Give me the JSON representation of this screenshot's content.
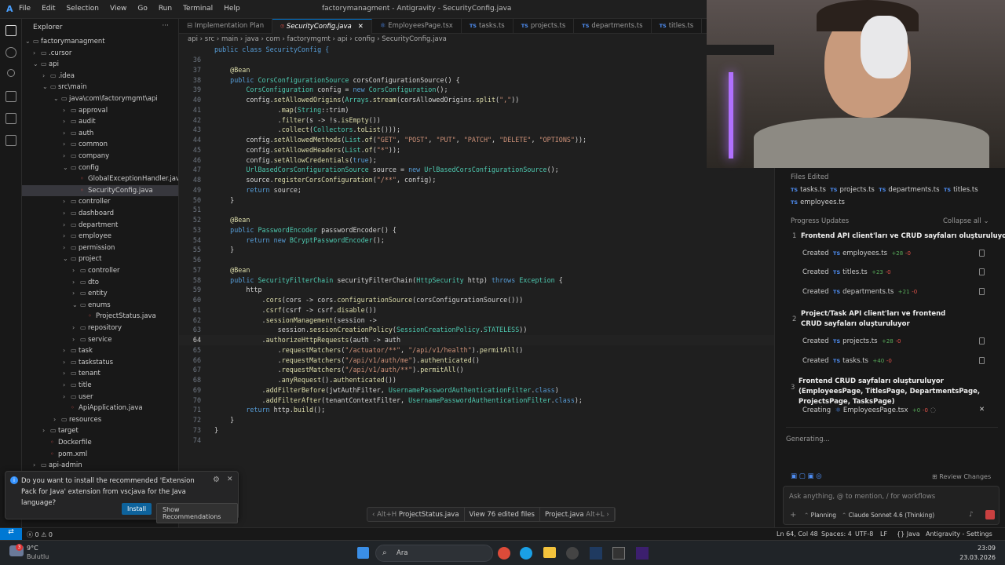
{
  "window": {
    "title": "factorymanagment - Antigravity - SecurityConfig.java"
  },
  "menu": [
    "File",
    "Edit",
    "Selection",
    "View",
    "Go",
    "Run",
    "Terminal",
    "Help"
  ],
  "explorer": {
    "header": "Explorer",
    "items": [
      {
        "label": "factorymanagment",
        "chev": "⌄"
      },
      {
        "label": ".cursor",
        "chev": "›"
      },
      {
        "label": "api",
        "chev": "⌄"
      },
      {
        "label": ".idea",
        "chev": "›"
      },
      {
        "label": "src\\main",
        "chev": "⌄"
      },
      {
        "label": "java\\com\\factorymgmt\\api",
        "chev": "⌄"
      },
      {
        "label": "approval",
        "chev": "›"
      },
      {
        "label": "audit",
        "chev": "›"
      },
      {
        "label": "auth",
        "chev": "›"
      },
      {
        "label": "common",
        "chev": "›"
      },
      {
        "label": "company",
        "chev": "›"
      },
      {
        "label": "config",
        "chev": "⌄"
      },
      {
        "label": "GlobalExceptionHandler.java",
        "chev": ""
      },
      {
        "label": "SecurityConfig.java",
        "chev": ""
      },
      {
        "label": "controller",
        "chev": "›"
      },
      {
        "label": "dashboard",
        "chev": "›"
      },
      {
        "label": "department",
        "chev": "›"
      },
      {
        "label": "employee",
        "chev": "›"
      },
      {
        "label": "permission",
        "chev": "›"
      },
      {
        "label": "project",
        "chev": "⌄"
      },
      {
        "label": "controller",
        "chev": "›"
      },
      {
        "label": "dto",
        "chev": "›"
      },
      {
        "label": "entity",
        "chev": "›"
      },
      {
        "label": "enums",
        "chev": "⌄"
      },
      {
        "label": "ProjectStatus.java",
        "chev": ""
      },
      {
        "label": "repository",
        "chev": "›"
      },
      {
        "label": "service",
        "chev": "›"
      },
      {
        "label": "task",
        "chev": "›"
      },
      {
        "label": "taskstatus",
        "chev": "›"
      },
      {
        "label": "tenant",
        "chev": "›"
      },
      {
        "label": "title",
        "chev": "›"
      },
      {
        "label": "user",
        "chev": "›"
      },
      {
        "label": "ApiApplication.java",
        "chev": ""
      },
      {
        "label": "resources",
        "chev": "›"
      },
      {
        "label": "target",
        "chev": "›"
      },
      {
        "label": "Dockerfile",
        "chev": ""
      },
      {
        "label": "pom.xml",
        "chev": ""
      },
      {
        "label": "api-admin",
        "chev": "›"
      }
    ]
  },
  "tabs": [
    "Implementation Plan",
    "SecurityConfig.java",
    "EmployeesPage.tsx",
    "tasks.ts",
    "projects.ts",
    "departments.ts",
    "titles.ts"
  ],
  "breadcrumb": "api › src › main › java › com › factorymgmt › api › config › SecurityConfig.java",
  "code": {
    "header_line": "public class SecurityConfig {",
    "lines": [
      {
        "n": "36",
        "t": ""
      },
      {
        "n": "37",
        "t": "    @Bean"
      },
      {
        "n": "38",
        "t": "    public CorsConfigurationSource corsConfigurationSource() {"
      },
      {
        "n": "39",
        "t": "        CorsConfiguration config = new CorsConfiguration();"
      },
      {
        "n": "40",
        "t": "        config.setAllowedOrigins(Arrays.stream(corsAllowedOrigins.split(\",\"))"
      },
      {
        "n": "41",
        "t": "                .map(String::trim)"
      },
      {
        "n": "42",
        "t": "                .filter(s -> !s.isEmpty())"
      },
      {
        "n": "43",
        "t": "                .collect(Collectors.toList()));"
      },
      {
        "n": "44",
        "t": "        config.setAllowedMethods(List.of(\"GET\", \"POST\", \"PUT\", \"PATCH\", \"DELETE\", \"OPTIONS\"));"
      },
      {
        "n": "45",
        "t": "        config.setAllowedHeaders(List.of(\"*\"));"
      },
      {
        "n": "46",
        "t": "        config.setAllowCredentials(true);"
      },
      {
        "n": "47",
        "t": "        UrlBasedCorsConfigurationSource source = new UrlBasedCorsConfigurationSource();"
      },
      {
        "n": "48",
        "t": "        source.registerCorsConfiguration(\"/**\", config);"
      },
      {
        "n": "49",
        "t": "        return source;"
      },
      {
        "n": "50",
        "t": "    }"
      },
      {
        "n": "51",
        "t": ""
      },
      {
        "n": "52",
        "t": "    @Bean"
      },
      {
        "n": "53",
        "t": "    public PasswordEncoder passwordEncoder() {"
      },
      {
        "n": "54",
        "t": "        return new BCryptPasswordEncoder();"
      },
      {
        "n": "55",
        "t": "    }"
      },
      {
        "n": "56",
        "t": ""
      },
      {
        "n": "57",
        "t": "    @Bean"
      },
      {
        "n": "58",
        "t": "    public SecurityFilterChain securityFilterChain(HttpSecurity http) throws Exception {"
      },
      {
        "n": "59",
        "t": "        http"
      },
      {
        "n": "60",
        "t": "            .cors(cors -> cors.configurationSource(corsConfigurationSource()))"
      },
      {
        "n": "61",
        "t": "            .csrf(csrf -> csrf.disable())"
      },
      {
        "n": "62",
        "t": "            .sessionManagement(session ->"
      },
      {
        "n": "63",
        "t": "                session.sessionCreationPolicy(SessionCreationPolicy.STATELESS))"
      },
      {
        "n": "64",
        "t": "            .authorizeHttpRequests(auth -> auth"
      },
      {
        "n": "65",
        "t": "                .requestMatchers(\"/actuator/**\", \"/api/v1/health\").permitAll()"
      },
      {
        "n": "66",
        "t": "                .requestMatchers(\"/api/v1/auth/me\").authenticated()"
      },
      {
        "n": "67",
        "t": "                .requestMatchers(\"/api/v1/auth/**\").permitAll()"
      },
      {
        "n": "68",
        "t": "                .anyRequest().authenticated())"
      },
      {
        "n": "69",
        "t": "            .addFilterBefore(jwtAuthFilter, UsernamePasswordAuthenticationFilter.class)"
      },
      {
        "n": "70",
        "t": "            .addFilterAfter(tenantContextFilter, UsernamePasswordAuthenticationFilter.class);"
      },
      {
        "n": "71",
        "t": "        return http.build();"
      },
      {
        "n": "72",
        "t": "    }"
      },
      {
        "n": "73",
        "t": "}"
      },
      {
        "n": "74",
        "t": ""
      }
    ]
  },
  "notification": {
    "text": "Do you want to install the recommended 'Extension Pack for Java' extension from vscjava for the Java language?",
    "install": "Install",
    "show": "Show Recommendations"
  },
  "bottom_tabs": {
    "a": "Alt+H",
    "b": "ProjectStatus.java",
    "c": "View 76 edited files",
    "d": "Project.java",
    "e": "Alt+L"
  },
  "agent": {
    "files_edited_label": "Files Edited",
    "files_edited": [
      "tasks.ts",
      "projects.ts",
      "departments.ts",
      "titles.ts",
      "employees.ts"
    ],
    "progress_label": "Progress Updates",
    "collapse_all": "Collapse all",
    "ts_badge": "TS",
    "steps": [
      {
        "num": "1",
        "title": "Frontend API client'ları ve CRUD sayfaları oluşturuluyor"
      },
      {
        "num": "2",
        "title": "Project/Task API client'ları ve frontend CRUD sayfaları oluşturuluyor"
      },
      {
        "num": "3",
        "title": "Frontend CRUD sayfaları oluşturuluyor (EmployeesPage, TitlesPage, DepartmentsPage, ProjectsPage, TasksPage)"
      }
    ],
    "created": [
      {
        "verb": "Created",
        "file": "employees.ts",
        "add": "+28",
        "del": "-0"
      },
      {
        "verb": "Created",
        "file": "titles.ts",
        "add": "+23",
        "del": "-0"
      },
      {
        "verb": "Created",
        "file": "departments.ts",
        "add": "+21",
        "del": "-0"
      },
      {
        "verb": "Created",
        "file": "projects.ts",
        "add": "+28",
        "del": "-0"
      },
      {
        "verb": "Created",
        "file": "tasks.ts",
        "add": "+40",
        "del": "-0"
      },
      {
        "verb": "Creating",
        "file": "EmployeesPage.tsx",
        "add": "+0",
        "del": "-0"
      }
    ],
    "generating": "Generating...",
    "review_changes": "Review Changes",
    "input_placeholder": "Ask anything, @ to mention, / for workflows",
    "mode": "Planning",
    "model": "Claude Sonnet 4.6 (Thinking)"
  },
  "status": {
    "errors": "0",
    "warnings": "0",
    "position": "Ln 64, Col 48",
    "spaces": "Spaces: 4",
    "encoding": "UTF-8",
    "eol": "LF",
    "lang": "Java",
    "settings": "Antigravity - Settings"
  },
  "taskbar": {
    "temp": "9°C",
    "weather": "Bulutlu",
    "search": "Ara",
    "time": "23:09",
    "date": "23.03.2026"
  }
}
